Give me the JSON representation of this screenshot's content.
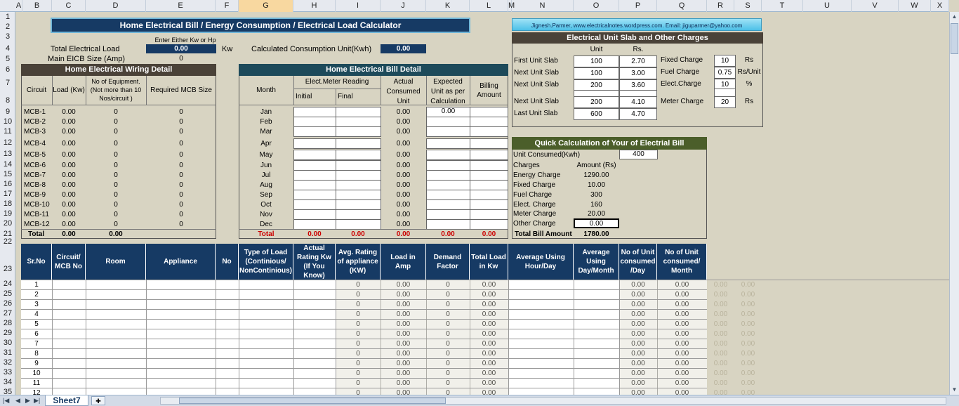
{
  "columns": [
    "A",
    "B",
    "C",
    "D",
    "E",
    "F",
    "G",
    "H",
    "I",
    "J",
    "K",
    "L",
    "M",
    "N",
    "O",
    "P",
    "Q",
    "R",
    "S",
    "T",
    "U",
    "V",
    "W",
    "X"
  ],
  "rows": [
    "1",
    "2",
    "3",
    "4",
    "5",
    "6",
    "7",
    "8",
    "9",
    "10",
    "11",
    "12",
    "13",
    "14",
    "15",
    "16",
    "17",
    "18",
    "19",
    "20",
    "21",
    "22",
    "23",
    "24",
    "25",
    "26",
    "27",
    "28",
    "29",
    "30",
    "31",
    "32",
    "33",
    "34",
    "35"
  ],
  "title": "Home Electrical Bill / Energy Consumption / Electrical Load Calculator",
  "author": "Jignesh.Parmer, www.electricalnotes.wordpress.com. Email: jiguparmer@yahoo.com",
  "inputs": {
    "hint": "Enter Either Kw or Hp",
    "total_load_label": "Total Electrical Load",
    "total_load_value": "0.00",
    "total_load_unit": "Kw",
    "main_eicb_label": "Main EICB Size (Amp)",
    "main_eicb_value": "0",
    "consumption_label": "Calculated Consumption Unit(Kwh)",
    "consumption_value": "0.00"
  },
  "wiring": {
    "title": "Home Electrical Wiring Detail",
    "headers": [
      "Circuit",
      "Load (Kw)",
      "No of Equipment. (Not more than 10 Nos/circuit )",
      "Required MCB Size"
    ],
    "rows": [
      [
        "MCB-1",
        "0.00",
        "0",
        "0"
      ],
      [
        "MCB-2",
        "0.00",
        "0",
        "0"
      ],
      [
        "MCB-3",
        "0.00",
        "0",
        "0"
      ],
      [
        "MCB-4",
        "0.00",
        "0",
        "0"
      ],
      [
        "MCB-5",
        "0.00",
        "0",
        "0"
      ],
      [
        "MCB-6",
        "0.00",
        "0",
        "0"
      ],
      [
        "MCB-7",
        "0.00",
        "0",
        "0"
      ],
      [
        "MCB-8",
        "0.00",
        "0",
        "0"
      ],
      [
        "MCB-9",
        "0.00",
        "0",
        "0"
      ],
      [
        "MCB-10",
        "0.00",
        "0",
        "0"
      ],
      [
        "MCB-11",
        "0.00",
        "0",
        "0"
      ],
      [
        "MCB-12",
        "0.00",
        "0",
        "0"
      ]
    ],
    "total": [
      "Total",
      "0.00",
      "0.00",
      ""
    ]
  },
  "bill": {
    "title": "Home Electrical Bill Detail",
    "month_header": "Month",
    "meter_header": "Elect.Meter Reading",
    "initial_header": "Initial",
    "final_header": "Final",
    "actual_header": "Actual Consumed Unit",
    "expected_header": "Expected Unit as per Calculation",
    "billing_header": "Billing Amount",
    "months": [
      "Jan",
      "Feb",
      "Mar",
      "Apr",
      "May",
      "Jun",
      "Jul",
      "Aug",
      "Sep",
      "Oct",
      "Nov",
      "Dec"
    ],
    "actual": [
      "0.00",
      "0.00",
      "0.00",
      "0.00",
      "0.00",
      "0.00",
      "0.00",
      "0.00",
      "0.00",
      "0.00",
      "0.00",
      "0.00"
    ],
    "expected_first": "0.00",
    "total": [
      "Total",
      "0.00",
      "0.00",
      "0.00",
      "0.00",
      "0.00"
    ]
  },
  "slab": {
    "title": "Electrical Unit Slab and Other Charges",
    "unit_header": "Unit",
    "rs_header": "Rs.",
    "rows": [
      [
        "First Unit Slab",
        "100",
        "2.70"
      ],
      [
        "Next Unit Slab",
        "100",
        "3.00"
      ],
      [
        "Next Unit Slab",
        "200",
        "3.60"
      ],
      [
        "Next Unit Slab",
        "200",
        "4.10"
      ],
      [
        "Last Unit Slab",
        "600",
        "4.70"
      ]
    ],
    "charges": [
      [
        "Fixed Charge",
        "10",
        "Rs"
      ],
      [
        "Fuel Charge",
        "0.75",
        "Rs/Unit"
      ],
      [
        "Elect.Charge",
        "10",
        "%"
      ],
      [
        "Meter Charge",
        "20",
        "Rs"
      ]
    ]
  },
  "quick": {
    "title": "Quick Calculation of Your of Electrial Bill",
    "unit_consumed_label": "Unit Consumed(Kwh)",
    "unit_consumed_value": "400",
    "charges_label": "Charges",
    "amount_label": "Amount (Rs)",
    "rows": [
      [
        "Energy Charge",
        "1290.00"
      ],
      [
        "Fixed Charge",
        "10.00"
      ],
      [
        "Fuel Charge",
        "300"
      ],
      [
        "Elect. Charge",
        "160"
      ],
      [
        "Meter Charge",
        "20.00"
      ]
    ],
    "other_label": "Other Charge",
    "other_value": "0.00",
    "total_label": "Total Bill Amount",
    "total_value": "1780.00"
  },
  "load_table": {
    "headers": [
      "Sr.No",
      "Circuit/ MCB No",
      "Room",
      "Appliance",
      "No",
      "Type of Load (Continious/ NonContinious)",
      "Actual Rating Kw (If You Know)",
      "Avg. Rating of appliance (KW)",
      "Load in Amp",
      "Demand Factor",
      "Total Load in Kw",
      "Average Using Hour/Day",
      "Average Using Day/Month",
      "No of Unit consumed /Day",
      "No of Unit consumed/ Month"
    ],
    "rows": [
      [
        "1",
        "0",
        "0.00",
        "0",
        "0.00",
        "0.00",
        "0.00"
      ],
      [
        "2",
        "0",
        "0.00",
        "0",
        "0.00",
        "0.00",
        "0.00"
      ],
      [
        "3",
        "0",
        "0.00",
        "0",
        "0.00",
        "0.00",
        "0.00"
      ],
      [
        "4",
        "0",
        "0.00",
        "0",
        "0.00",
        "0.00",
        "0.00"
      ],
      [
        "5",
        "0",
        "0.00",
        "0",
        "0.00",
        "0.00",
        "0.00"
      ],
      [
        "6",
        "0",
        "0.00",
        "0",
        "0.00",
        "0.00",
        "0.00"
      ],
      [
        "7",
        "0",
        "0.00",
        "0",
        "0.00",
        "0.00",
        "0.00"
      ],
      [
        "8",
        "0",
        "0.00",
        "0",
        "0.00",
        "0.00",
        "0.00"
      ],
      [
        "9",
        "0",
        "0.00",
        "0",
        "0.00",
        "0.00",
        "0.00"
      ],
      [
        "10",
        "0",
        "0.00",
        "0",
        "0.00",
        "0.00",
        "0.00"
      ],
      [
        "11",
        "0",
        "0.00",
        "0",
        "0.00",
        "0.00",
        "0.00"
      ],
      [
        "12",
        "0",
        "0.00",
        "0",
        "0.00",
        "0.00",
        "0.00"
      ]
    ],
    "faint_r": "0.00",
    "faint_s": "0.00"
  },
  "sheet_tab": "Sheet7",
  "colors": {
    "navy": "#163a64",
    "teal": "#1d4a5a",
    "green": "#4b5e2a",
    "dark": "#4a4238",
    "background": "#d8d4c2"
  }
}
